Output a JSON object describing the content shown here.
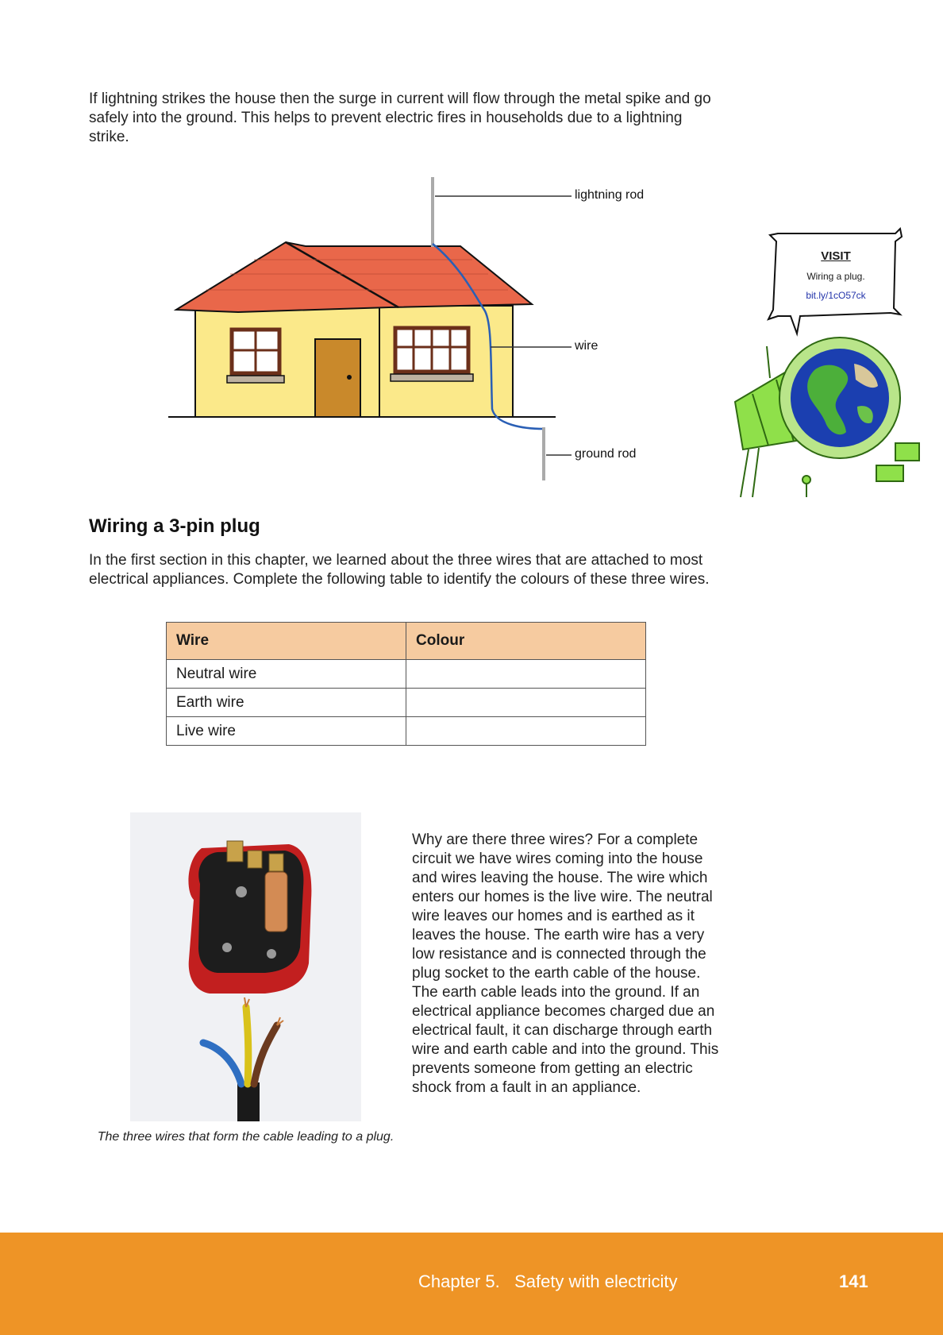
{
  "intro": "If lightning strikes the house then the surge in current will flow through the metal spike and go safely into the ground. This helps to prevent electric fires in households due to a lightning strike.",
  "diagram": {
    "labels": {
      "lightning_rod": "lightning rod",
      "wire": "wire",
      "ground_rod": "ground rod"
    }
  },
  "visit": {
    "title": "VISIT",
    "subtitle": "Wiring a plug.",
    "link": "bit.ly/1cO57ck"
  },
  "section": {
    "heading": "Wiring a 3-pin plug",
    "text": "In the first section in this chapter, we learned about the three wires that are attached to most electrical appliances. Complete the following table to identify the colours of these three wires."
  },
  "table": {
    "headers": [
      "Wire",
      "Colour"
    ],
    "rows": [
      [
        "Neutral wire",
        ""
      ],
      [
        "Earth wire",
        ""
      ],
      [
        "Live wire",
        ""
      ]
    ]
  },
  "photo": {
    "caption": "The three wires that form the cable leading to a plug."
  },
  "why_text": "Why are there three wires? For a complete circuit we have wires coming into the house and wires leaving the house. The wire which enters our homes is the live wire. The neutral wire leaves our homes and is earthed as it leaves the house. The earth wire has a very low resistance and is connected through the plug socket to the earth cable of the house. The earth cable leads into the ground. If an electrical appliance becomes charged due an electrical fault, it can discharge through earth wire and earth cable and into the ground. This prevents someone from getting an electric shock from a fault in an appliance.",
  "footer": {
    "chapter": "Chapter 5.   Safety with electricity",
    "page": "141"
  },
  "colors": {
    "footer": "#ee9426",
    "table_header": "#f6cba0",
    "roof": "#e9674a",
    "wall": "#fbe98a",
    "wire": "#2a5fb5"
  }
}
